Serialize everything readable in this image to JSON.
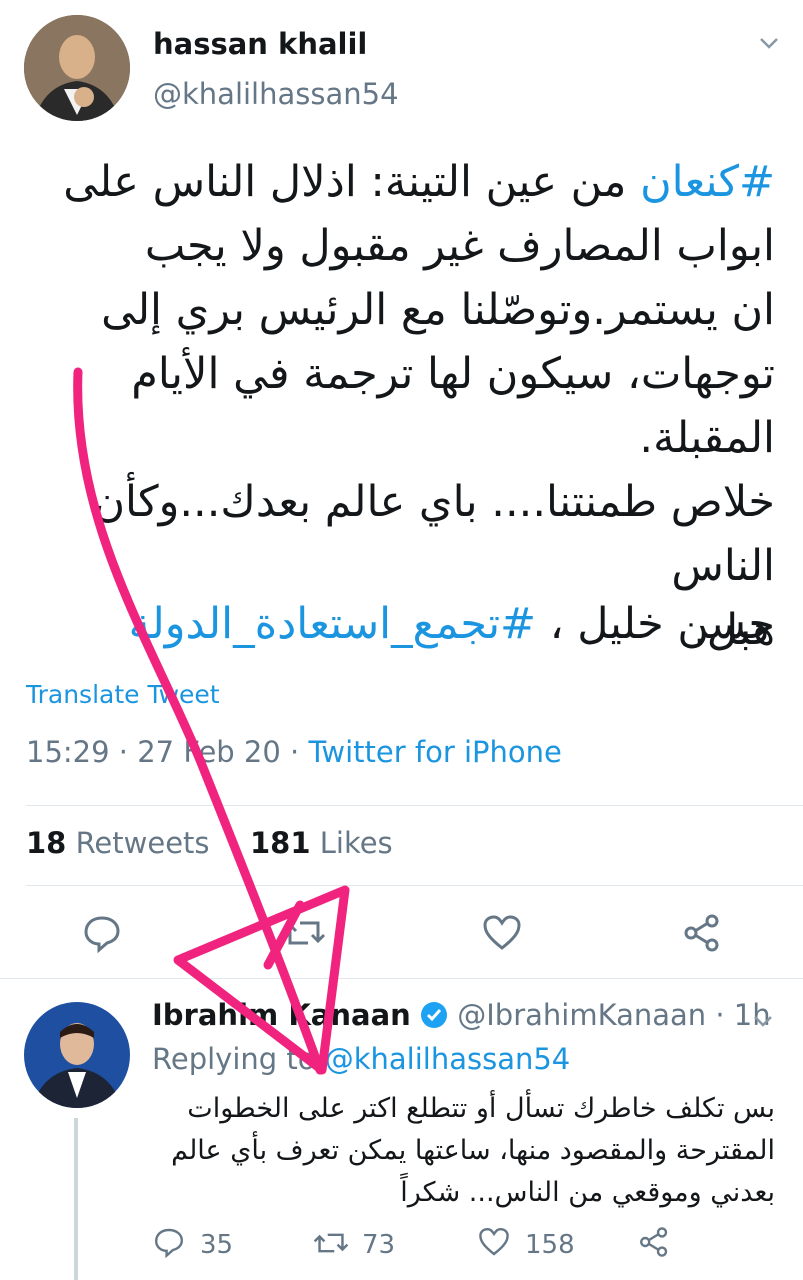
{
  "main_tweet": {
    "author_name": "hassan khalil",
    "author_handle": "@khalilhassan54",
    "text_lines": [
      "من عين التينة: اذلال الناس على",
      "ابواب المصارف غير مقبول ولا يجب",
      "ان يستمر.وتوصّلنا مع الرئيس بري إلى",
      "توجهات، سيكون لها ترجمة في الأيام المقبلة.",
      "خلاص طمنتنا.... باي عالم بعدك...وكأن الناس",
      "هبل."
    ],
    "hashtag_first": "#كنعان",
    "signature_prefix": "حسن خليل ، ",
    "signature_hashtag": "#تجمع_استعادة_الدولة",
    "translate_label": "Translate Tweet",
    "timestamp": "15:29 · 27 Feb 20 · ",
    "source": "Twitter for iPhone",
    "retweets_count": "18",
    "retweets_label": "Retweets",
    "likes_count": "181",
    "likes_label": "Likes"
  },
  "reply_tweet": {
    "author_name": "Ibrahim Kanaan",
    "author_handle": "@IbrahimKanaan",
    "time_ago": "· 1h",
    "replying_to_label": "Replying to",
    "replying_to_handle": "@khalilhassan54",
    "text_lines": [
      "بس تكلف خاطرك تسأل أو تتطلع اكتر على الخطوات",
      "المقترحة والمقصود منها، ساعتها يمكن تعرف بأي عالم",
      "بعدني وموقعي من الناس... شكراً"
    ],
    "reply_count": "35",
    "retweet_count": "73",
    "like_count": "158"
  },
  "colors": {
    "link": "#1b95e0",
    "annotation": "#f0247f",
    "verified": "#1da1f2"
  }
}
